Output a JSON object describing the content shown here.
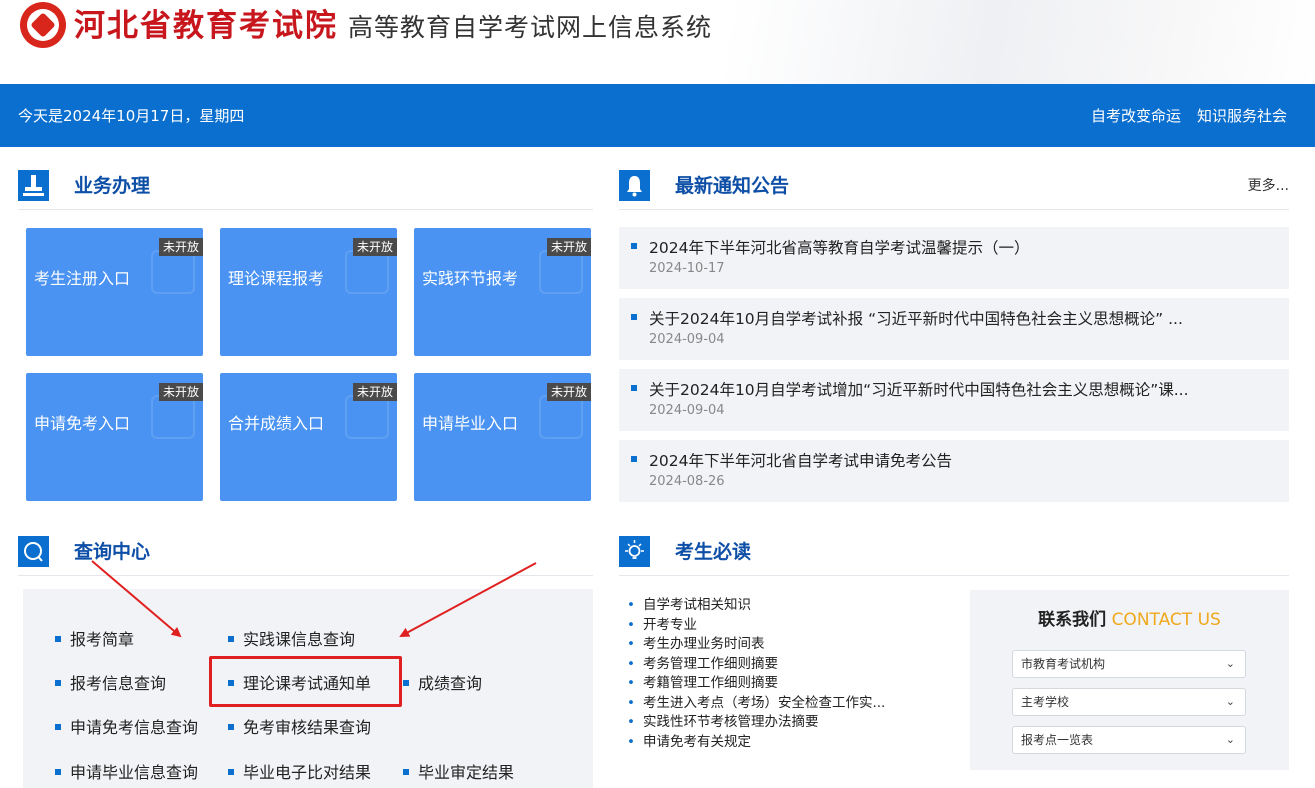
{
  "header": {
    "title": "河北省教育考试院",
    "subtitle": "高等教育自学考试网上信息系统"
  },
  "topbar": {
    "date": "今天是2024年10月17日，星期四",
    "slogan_1": "自考改变命运",
    "slogan_2": "知识服务社会"
  },
  "business": {
    "title": "业务办理",
    "badge": "未开放",
    "tiles": [
      {
        "label": "考生注册入口",
        "badge": "未开放"
      },
      {
        "label": "理论课程报考",
        "badge": "未开放"
      },
      {
        "label": "实践环节报考",
        "badge": "未开放"
      },
      {
        "label": "申请免考入口",
        "badge": "未开放"
      },
      {
        "label": "合并成绩入口",
        "badge": "未开放"
      },
      {
        "label": "申请毕业入口",
        "badge": "未开放"
      }
    ]
  },
  "notices": {
    "title": "最新通知公告",
    "more": "更多...",
    "items": [
      {
        "title": "2024年下半年河北省高等教育自学考试温馨提示（一）",
        "date": "2024-10-17"
      },
      {
        "title": "关于2024年10月自学考试补报 “习近平新时代中国特色社会主义思想概论” ...",
        "date": "2024-09-04"
      },
      {
        "title": "关于2024年10月自学考试增加“习近平新时代中国特色社会主义思想概论”课...",
        "date": "2024-09-04"
      },
      {
        "title": "2024年下半年河北省自学考试申请免考公告",
        "date": "2024-08-26"
      }
    ]
  },
  "query": {
    "title": "查询中心",
    "items": [
      "报考简章",
      "实践课信息查询",
      "报考信息查询",
      "理论课考试通知单",
      "成绩查询",
      "申请免考信息查询",
      "免考审核结果查询",
      "申请毕业信息查询",
      "毕业电子比对结果",
      "毕业审定结果"
    ]
  },
  "must_read": {
    "title": "考生必读",
    "items": [
      "自学考试相关知识",
      "开考专业",
      "考生办理业务时间表",
      "考务管理工作细则摘要",
      "考籍管理工作细则摘要",
      "考生进入考点（考场）安全检查工作实...",
      "实践性环节考核管理办法摘要",
      "申请免考有关规定"
    ]
  },
  "contact": {
    "title_cn": "联系我们",
    "title_en": "CONTACT US",
    "selects": [
      "市教育考试机构",
      "主考学校",
      "报考点一览表"
    ]
  },
  "colors": {
    "brand_red": "#c8161d",
    "primary_blue": "#0a6fcf",
    "tile_blue": "#4a93f2",
    "annotation_red": "#e02020",
    "accent_orange": "#f0a81c"
  }
}
